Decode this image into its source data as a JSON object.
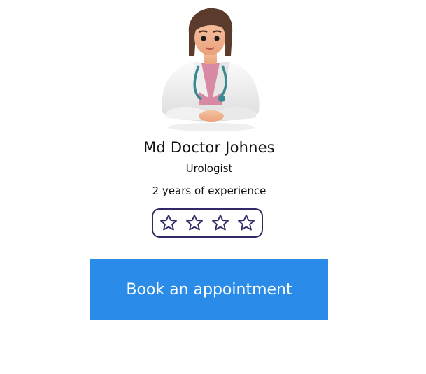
{
  "doctor": {
    "name": "Md Doctor Johnes",
    "specialty": "Urologist",
    "experience": "2 years of experience"
  },
  "rating": {
    "stars_total": 4,
    "stars_filled": 0,
    "star_icon": "star-outline-icon",
    "border_color": "#2f2a66"
  },
  "actions": {
    "book_label": "Book an appointment",
    "book_color": "#2a8be8"
  },
  "avatar": {
    "icon": "doctor-avatar-illustration"
  }
}
